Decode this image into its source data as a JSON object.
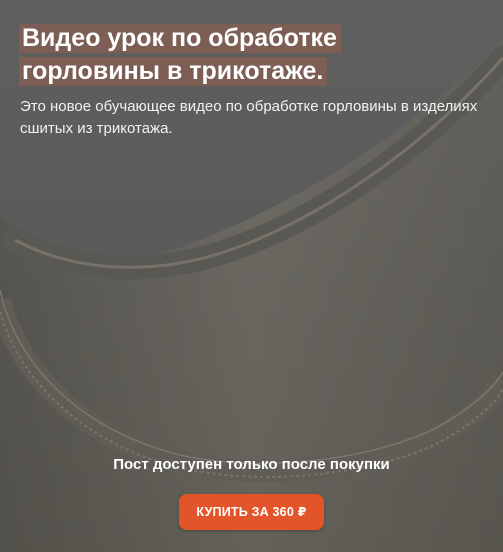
{
  "post": {
    "title_line1": "Видео урок по обработке",
    "title_line2": "горловины в трикотаже.",
    "description": "Это новое обучающее видео по обработке горловины в изделиях сшитых из трикотажа."
  },
  "paywall": {
    "notice": "Пост доступен только после покупки",
    "buy_label": "КУПИТЬ ЗА 360 ₽"
  },
  "colors": {
    "accent": "#e2552a",
    "title_highlight": "#965f4e",
    "fabric": "#6b6961"
  }
}
